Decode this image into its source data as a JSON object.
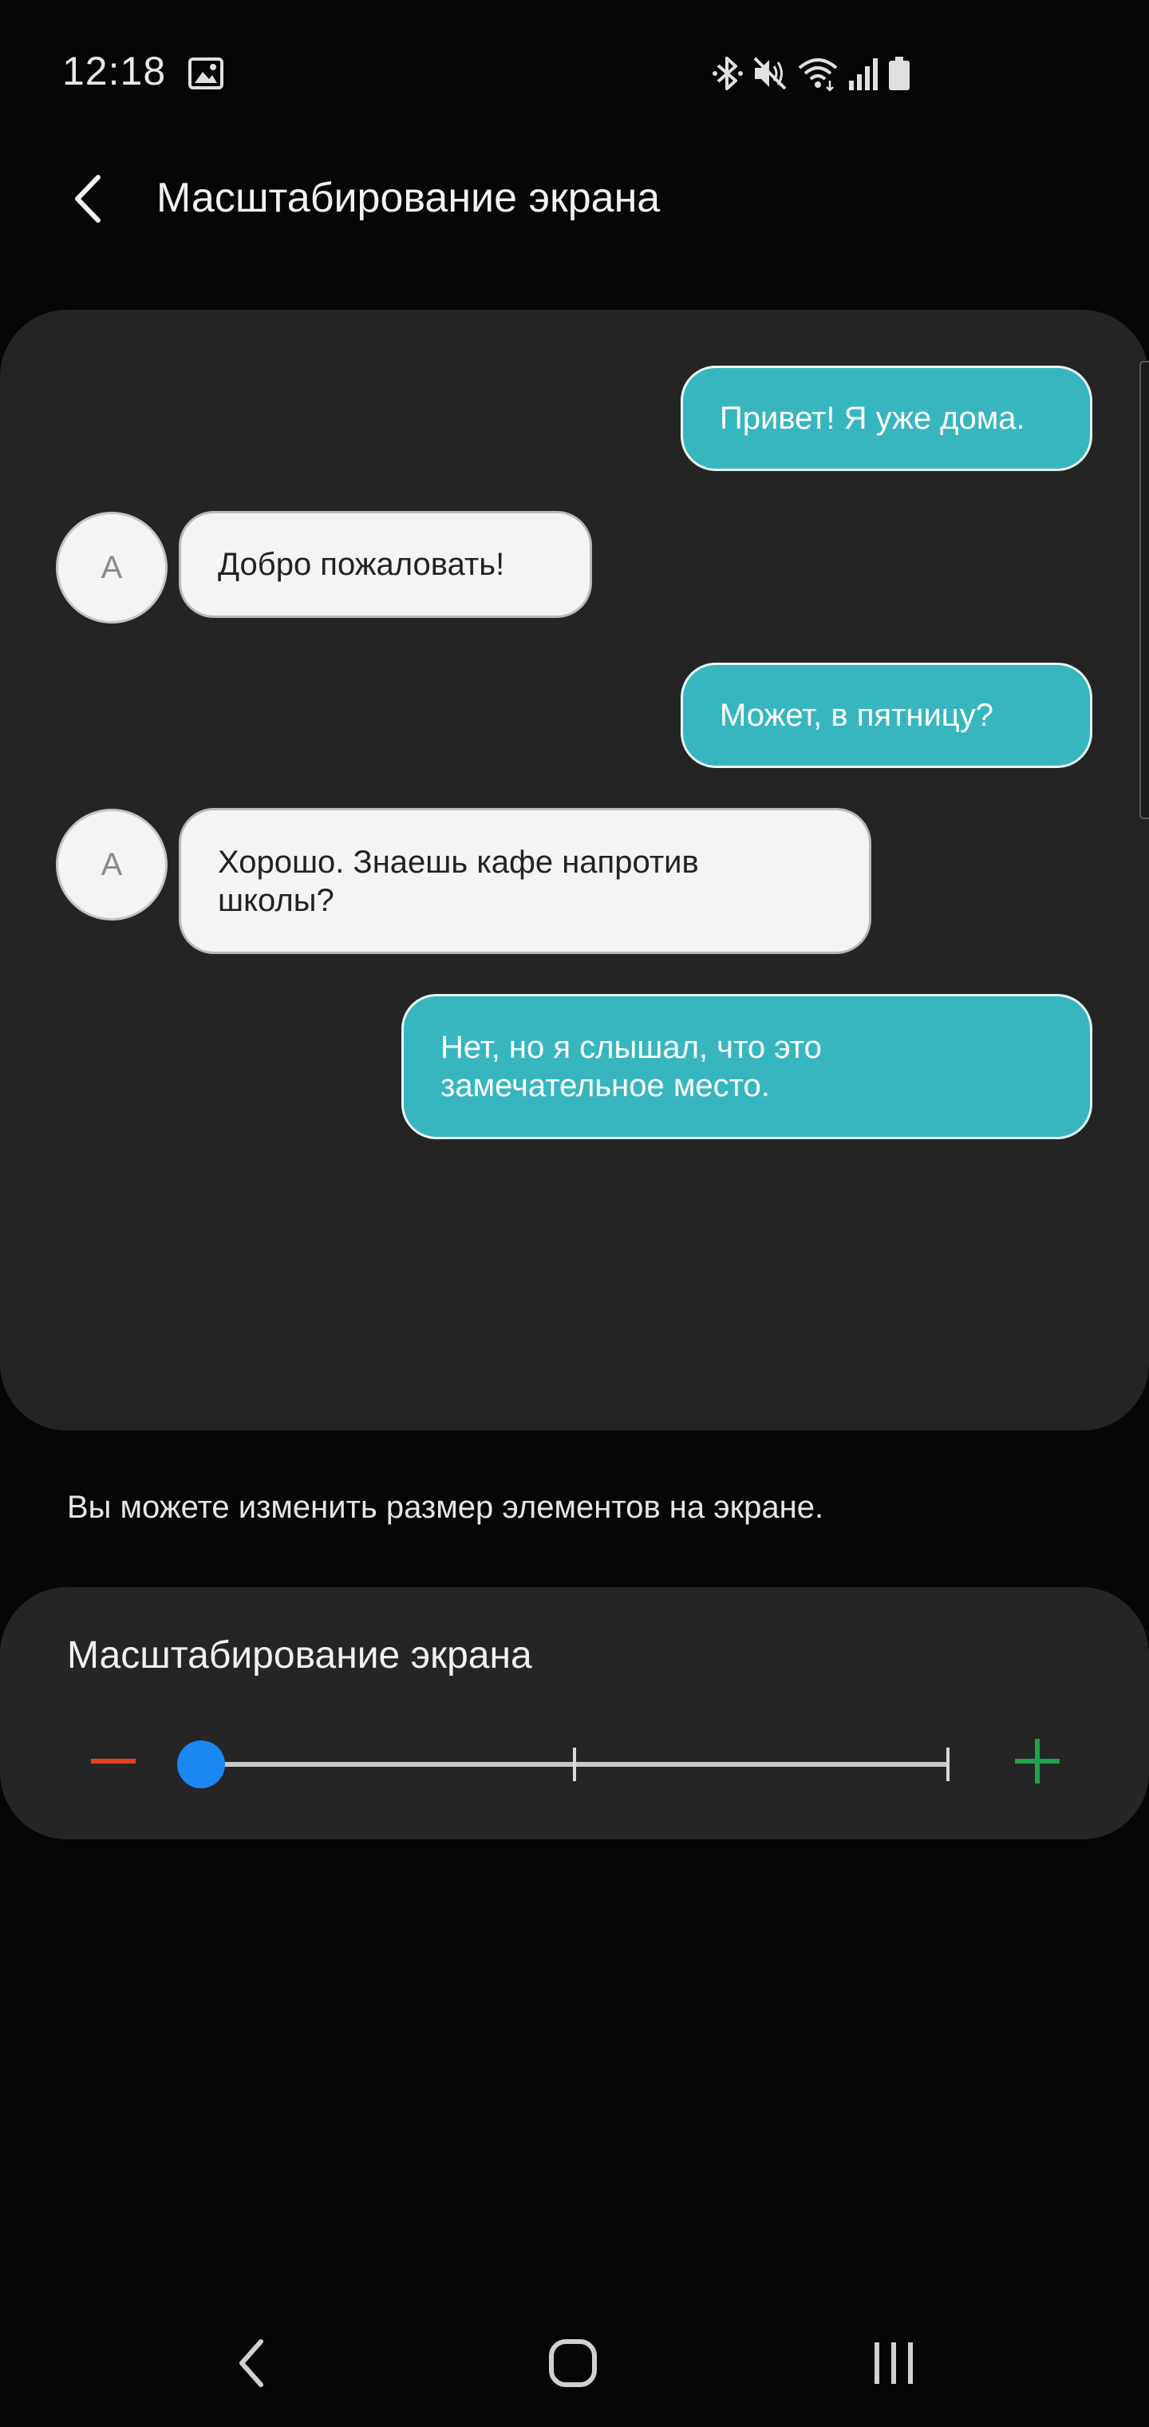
{
  "status_bar": {
    "time": "12:18",
    "icons": [
      "gallery-icon",
      "bluetooth-icon",
      "mute-icon",
      "wifi-icon",
      "signal-icon",
      "battery-icon"
    ]
  },
  "header": {
    "title": "Масштабирование экрана"
  },
  "preview": {
    "avatar_letter": "A",
    "messages": [
      {
        "side": "out",
        "text": "Привет! Я уже дома."
      },
      {
        "side": "in",
        "text": "Добро пожаловать!"
      },
      {
        "side": "out",
        "text": "Может, в пятницу?"
      },
      {
        "side": "in",
        "text": "Хорошо. Знаешь кафе напротив школы?"
      },
      {
        "side": "out",
        "text": "Нет, но я слышал, что это замечательное место."
      }
    ]
  },
  "description": "Вы можете изменить размер элементов на экране.",
  "zoom": {
    "title": "Масштабирование экрана",
    "levels": 3,
    "selected_level": 0
  },
  "colors": {
    "outgoing_bubble": "#38b6bf",
    "incoming_bubble": "#f4f4f4",
    "slider_thumb": "#1a87f3",
    "minus": "#e8401c",
    "plus": "#1fa34a",
    "card_bg": "#242424",
    "page_bg": "#060606"
  },
  "nav_bar": {
    "icons": [
      "nav-back-icon",
      "nav-home-icon",
      "nav-recents-icon"
    ]
  }
}
